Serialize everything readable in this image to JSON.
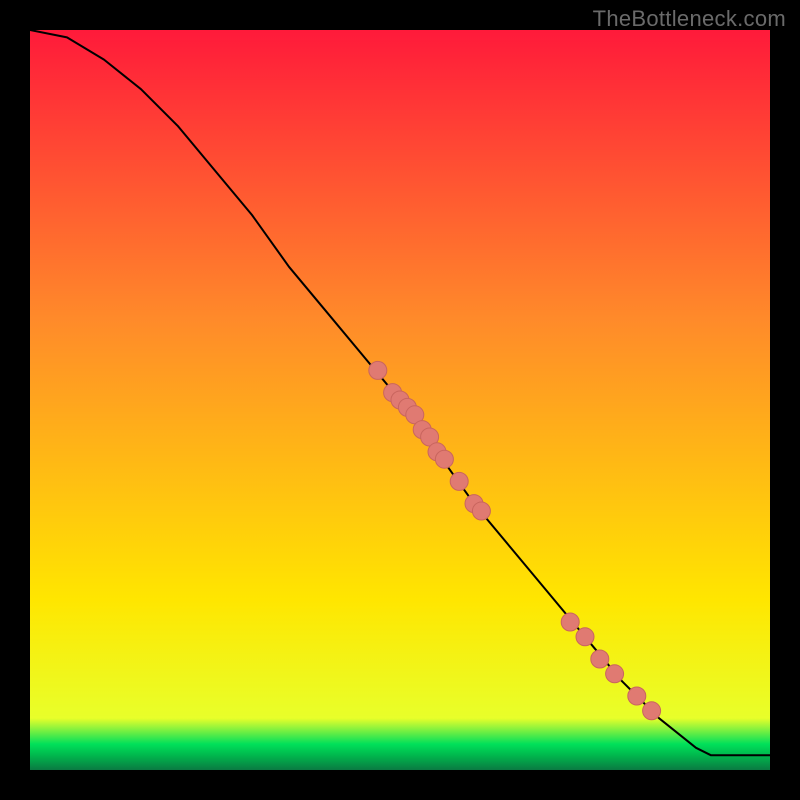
{
  "watermark": {
    "text": "TheBottleneck.com"
  },
  "chart_data": {
    "type": "line",
    "title": "",
    "xlabel": "",
    "ylabel": "",
    "xlim": [
      0,
      100
    ],
    "ylim": [
      0,
      100
    ],
    "grid": false,
    "legend": false,
    "curve": [
      {
        "x": 0,
        "y": 100
      },
      {
        "x": 5,
        "y": 99
      },
      {
        "x": 10,
        "y": 96
      },
      {
        "x": 15,
        "y": 92
      },
      {
        "x": 20,
        "y": 87
      },
      {
        "x": 25,
        "y": 81
      },
      {
        "x": 30,
        "y": 75
      },
      {
        "x": 35,
        "y": 68
      },
      {
        "x": 40,
        "y": 62
      },
      {
        "x": 45,
        "y": 56
      },
      {
        "x": 50,
        "y": 50
      },
      {
        "x": 55,
        "y": 43
      },
      {
        "x": 60,
        "y": 36
      },
      {
        "x": 65,
        "y": 30
      },
      {
        "x": 70,
        "y": 24
      },
      {
        "x": 75,
        "y": 18
      },
      {
        "x": 80,
        "y": 12
      },
      {
        "x": 85,
        "y": 7
      },
      {
        "x": 90,
        "y": 3
      },
      {
        "x": 92,
        "y": 2
      },
      {
        "x": 100,
        "y": 2
      }
    ],
    "points": [
      {
        "x": 47,
        "y": 54
      },
      {
        "x": 49,
        "y": 51
      },
      {
        "x": 50,
        "y": 50
      },
      {
        "x": 51,
        "y": 49
      },
      {
        "x": 52,
        "y": 48
      },
      {
        "x": 53,
        "y": 46
      },
      {
        "x": 54,
        "y": 45
      },
      {
        "x": 55,
        "y": 43
      },
      {
        "x": 56,
        "y": 42
      },
      {
        "x": 58,
        "y": 39
      },
      {
        "x": 60,
        "y": 36
      },
      {
        "x": 61,
        "y": 35
      },
      {
        "x": 73,
        "y": 20
      },
      {
        "x": 75,
        "y": 18
      },
      {
        "x": 77,
        "y": 15
      },
      {
        "x": 79,
        "y": 13
      },
      {
        "x": 82,
        "y": 10
      },
      {
        "x": 84,
        "y": 8
      }
    ],
    "palette": {
      "gradient_top": "#ff1a3a",
      "gradient_mid": "#ffe600",
      "gradient_band": "#00e05a",
      "gradient_bottom": "#0a7a42",
      "line": "#000000",
      "point_fill": "#e07a72",
      "point_stroke": "#c9655e"
    }
  }
}
